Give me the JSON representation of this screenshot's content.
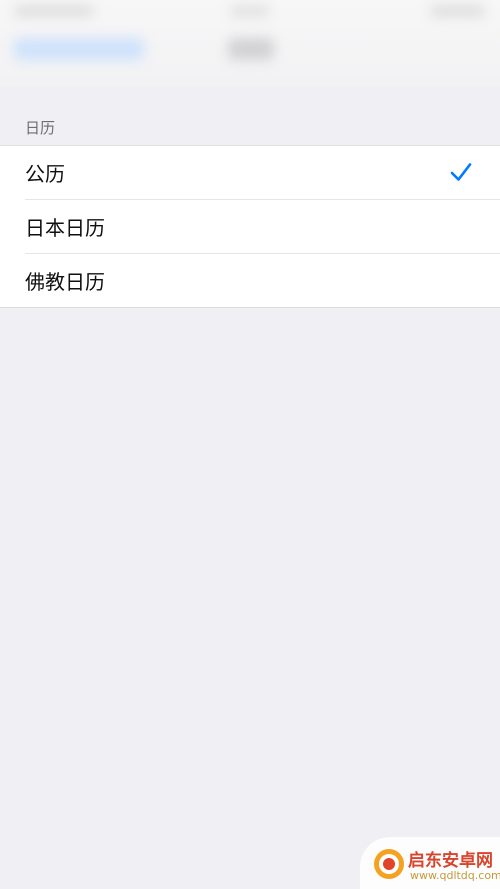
{
  "section": {
    "header": "日历"
  },
  "calendar_options": [
    {
      "label": "公历",
      "selected": true
    },
    {
      "label": "日本日历",
      "selected": false
    },
    {
      "label": "佛教日历",
      "selected": false
    }
  ],
  "accent_color": "#007aff",
  "watermark": {
    "title": "启东安卓网",
    "url": "www.qdltdq.com"
  }
}
